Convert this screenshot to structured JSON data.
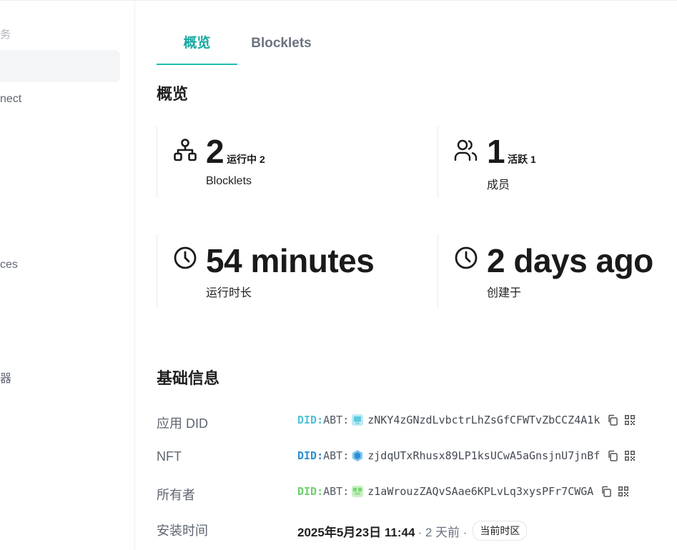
{
  "sidebar": {
    "section_label": "务",
    "items": [
      {
        "label": "nect"
      },
      {
        "label": "ces"
      },
      {
        "label": "器"
      }
    ]
  },
  "tabs": [
    {
      "label": "概览",
      "active": true
    },
    {
      "label": "Blocklets",
      "active": false
    }
  ],
  "overview": {
    "title": "概览",
    "stats": [
      {
        "icon": "network-icon",
        "value": "2",
        "sub": "运行中 2",
        "label": "Blocklets"
      },
      {
        "icon": "users-icon",
        "value": "1",
        "sub": "活跃 1",
        "label": "成员"
      },
      {
        "icon": "clock-icon",
        "value": "54 minutes",
        "sub": "",
        "label": "运行时长"
      },
      {
        "icon": "clock-icon",
        "value": "2 days ago",
        "sub": "",
        "label": "创建于"
      }
    ]
  },
  "basic_info": {
    "title": "基础信息",
    "rows": [
      {
        "label": "应用 DID",
        "prefix": "DID:",
        "abt": "ABT:",
        "value": "zNKY4zGNzdLvbctrLhZsGfCFWTvZbCCZ4A1k",
        "prefix_color": "#4fc3d9"
      },
      {
        "label": "NFT",
        "prefix": "DID:",
        "abt": "ABT:",
        "value": "zjdqUTxRhusx89LP1ksUCwA5aGnsjnU7jnBf",
        "prefix_color": "#2f8fd0"
      },
      {
        "label": "所有者",
        "prefix": "DID:",
        "abt": "ABT:",
        "value": "z1aWrouzZAQvSAae6KPLvLq3xysPFr7CWGA",
        "prefix_color": "#6fd06b"
      },
      {
        "label": "安装时间",
        "time": "2025年5月23日 11:44",
        "relative": "· 2 天前 ·",
        "badge": "当前时区"
      }
    ]
  },
  "colors": {
    "accent": "#1fbfb4",
    "text_muted": "#5f6672"
  }
}
